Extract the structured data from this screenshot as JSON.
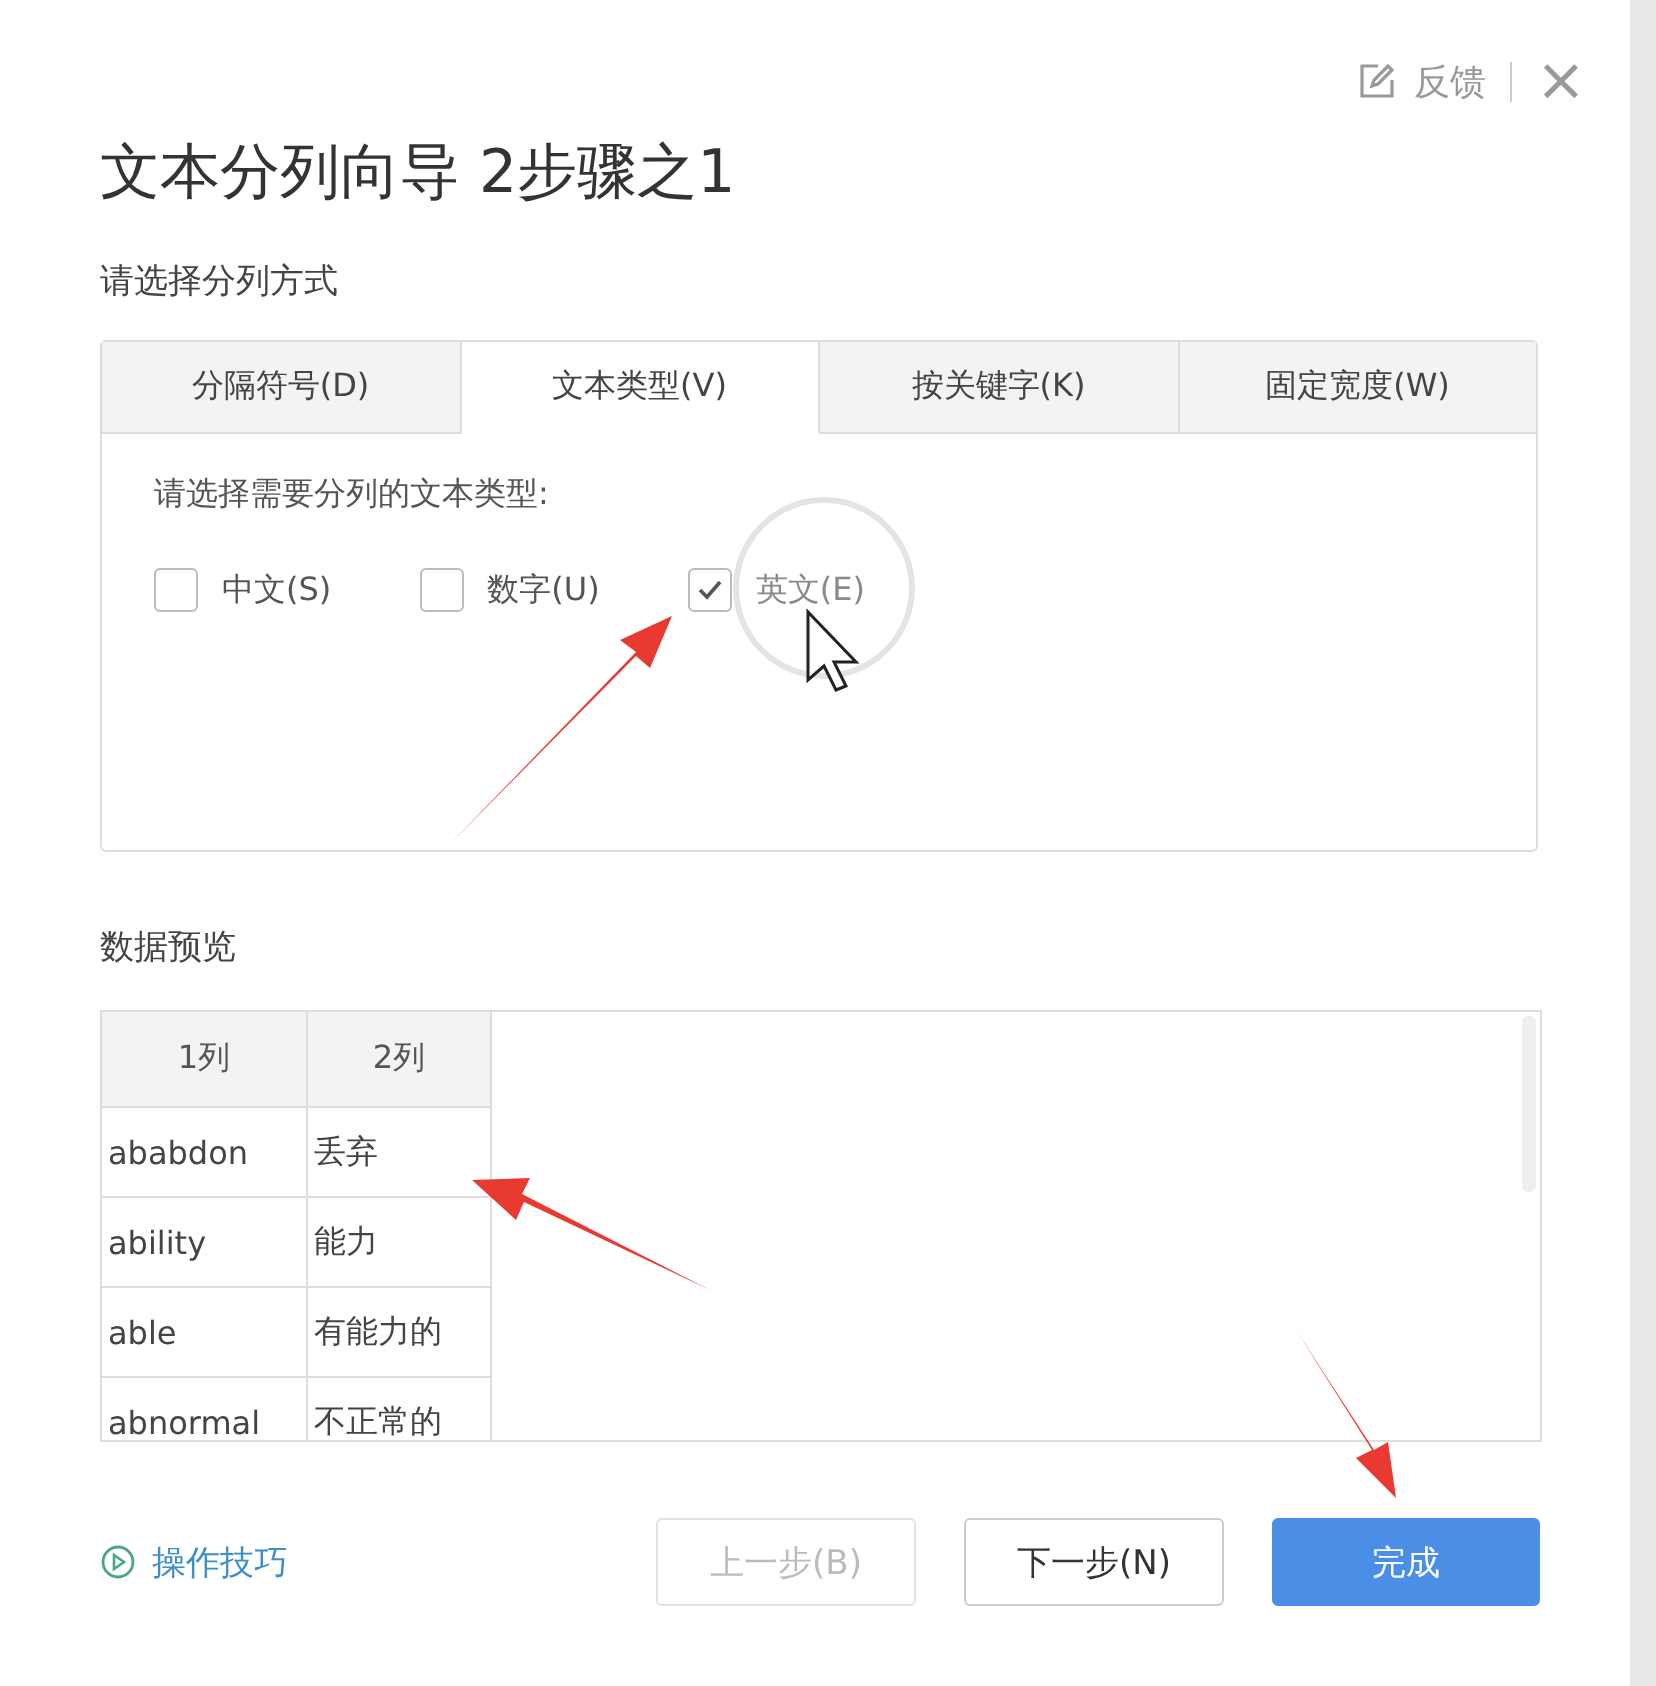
{
  "header": {
    "feedback": "反馈",
    "close": "×"
  },
  "title": "文本分列向导 2步骤之1",
  "subtitle": "请选择分列方式",
  "tabs": [
    {
      "label": "分隔符号(D)",
      "selected": false
    },
    {
      "label": "文本类型(V)",
      "selected": true
    },
    {
      "label": "按关键字(K)",
      "selected": false
    },
    {
      "label": "固定宽度(W)",
      "selected": false
    }
  ],
  "prompt": "请选择需要分列的文本类型:",
  "options": [
    {
      "label": "中文(S)",
      "checked": false
    },
    {
      "label": "数字(U)",
      "checked": false
    },
    {
      "label": "英文(E)",
      "checked": true
    }
  ],
  "preview": {
    "label": "数据预览",
    "columns": [
      "1列",
      "2列"
    ],
    "rows": [
      [
        "ababdon",
        "丢弃"
      ],
      [
        "ability",
        "能力"
      ],
      [
        "able",
        "有能力的"
      ],
      [
        "abnormal",
        "不正常的"
      ]
    ]
  },
  "help_link": "操作技巧",
  "buttons": [
    {
      "label": "上一步(B)",
      "kind": "default",
      "disabled": true
    },
    {
      "label": "下一步(N)",
      "kind": "default",
      "disabled": false
    },
    {
      "label": "完成",
      "kind": "primary",
      "disabled": false
    }
  ]
}
